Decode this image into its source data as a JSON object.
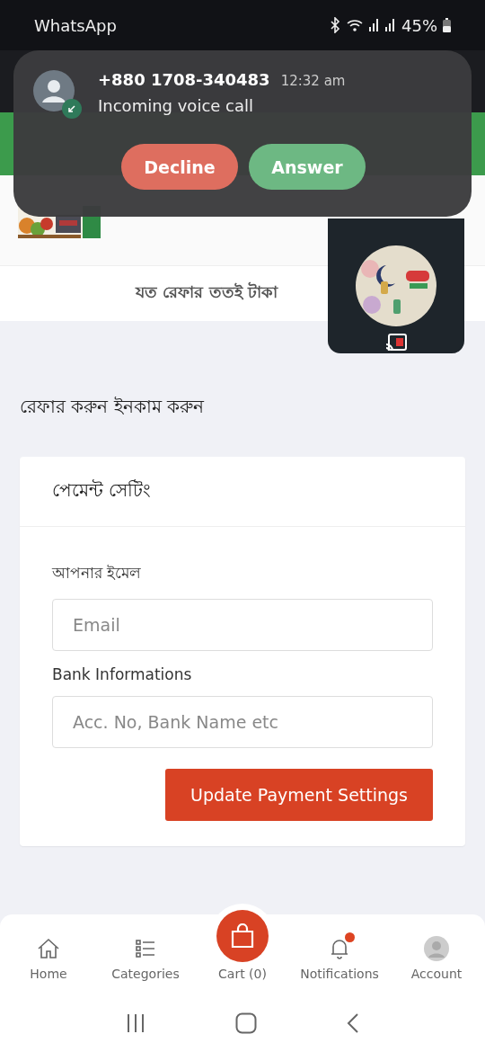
{
  "status_bar": {
    "app": "WhatsApp",
    "battery": "45%"
  },
  "call_notification": {
    "caller": "+880 1708-340483",
    "time": "12:32 am",
    "message": "Incoming voice call",
    "buttons": [
      {
        "label": "Decline",
        "kind": "decline"
      },
      {
        "label": "Answer",
        "kind": "answer"
      }
    ]
  },
  "tagline": "যত রেফার ততই টাকা",
  "page_heading": "রেফার করুন ইনকাম করুন",
  "payment_card": {
    "title": "পেমেন্ট সেটিং",
    "fields": [
      {
        "label": "আপনার ইমেল",
        "placeholder": "Email"
      },
      {
        "label": "Bank Informations",
        "placeholder": "Acc. No, Bank Name etc"
      }
    ],
    "submit": "Update Payment Settings"
  },
  "bottom_nav": [
    {
      "label": "Home",
      "kind": "home",
      "badge": false
    },
    {
      "label": "Categories",
      "kind": "categories",
      "badge": false
    },
    {
      "label": "Cart (0)",
      "kind": "cart",
      "badge": false
    },
    {
      "label": "Notifications",
      "kind": "notifications",
      "badge": true
    },
    {
      "label": "Account",
      "kind": "account",
      "badge": false
    }
  ]
}
